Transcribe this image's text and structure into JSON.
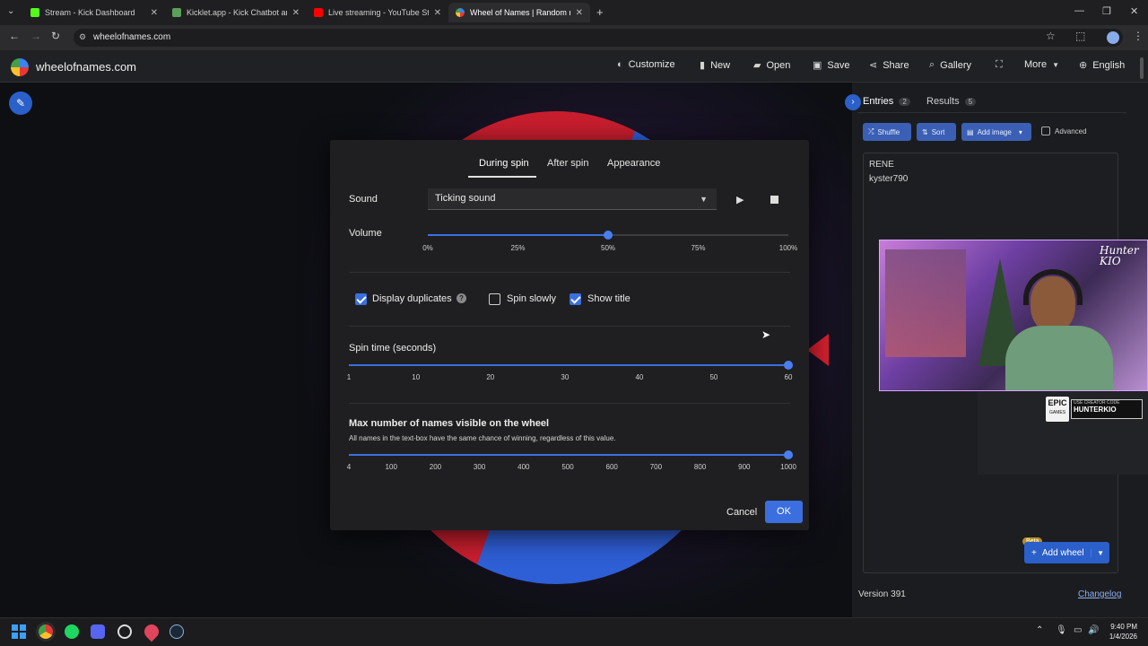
{
  "browser": {
    "tabs": [
      {
        "title": "Stream - Kick Dashboard",
        "color": "#53fc18"
      },
      {
        "title": "Kicklet.app - Kick Chatbot and",
        "color": "#5aa05a"
      },
      {
        "title": "Live streaming - YouTube Studio",
        "color": "#ff0000"
      },
      {
        "title": "Wheel of Names | Random name",
        "color": "#3b82f6"
      }
    ],
    "url": "wheelofnames.com"
  },
  "site": {
    "brand": "wheelofnames.com",
    "nav": [
      {
        "label": "Customize",
        "icon": "palette-icon"
      },
      {
        "label": "New",
        "icon": "file-icon"
      },
      {
        "label": "Open",
        "icon": "folder-icon"
      },
      {
        "label": "Save",
        "icon": "save-icon"
      },
      {
        "label": "Share",
        "icon": "share-icon"
      },
      {
        "label": "Gallery",
        "icon": "search-icon"
      },
      {
        "label": "More",
        "icon": "chevron-down-icon"
      },
      {
        "label": "English",
        "icon": "globe-icon"
      }
    ]
  },
  "sidebar": {
    "entries_label": "Entries",
    "entries_count": "2",
    "results_label": "Results",
    "results_count": "5",
    "shuffle": "Shuffle",
    "sort": "Sort",
    "add_image": "Add image",
    "advanced": "Advanced",
    "entries": [
      "RENE",
      "kyster790"
    ],
    "badge_beta": "Beta",
    "add_wheel": "Add wheel",
    "version": "Version 391",
    "changelog": "Changelog"
  },
  "overlay": {
    "brand_text": "Hunter KIO",
    "epic_line1": "EPIC",
    "epic_line2": "GAMES",
    "code_label": "USE CREATOR CODE",
    "code": "HUNTERKIO"
  },
  "modal": {
    "tabs": [
      "During spin",
      "After spin",
      "Appearance"
    ],
    "sound_label": "Sound",
    "sound_value": "Ticking sound",
    "volume_label": "Volume",
    "volume_value": 0.5,
    "volume_ticks": [
      "0%",
      "25%",
      "50%",
      "75%",
      "100%"
    ],
    "checkboxes": [
      {
        "label": "Display duplicates",
        "checked": true
      },
      {
        "label": "Spin slowly",
        "checked": false
      },
      {
        "label": "Show title",
        "checked": true
      }
    ],
    "spin_time_label": "Spin time (seconds)",
    "spin_time_value": 60,
    "spin_ticks": [
      "1",
      "10",
      "20",
      "30",
      "40",
      "50",
      "60"
    ],
    "max_names_label": "Max number of names visible on the wheel",
    "max_names_hint": "All names in the text-box have the same chance of winning, regardless of this value.",
    "max_names_value": 1000,
    "max_ticks": [
      "4",
      "100",
      "200",
      "300",
      "400",
      "500",
      "600",
      "700",
      "800",
      "900",
      "1000"
    ],
    "cancel": "Cancel",
    "ok": "OK"
  },
  "taskbar": {
    "time": "9:40 PM",
    "date": "1/4/2026"
  },
  "colors": {
    "accent": "#3b6fe0",
    "wheel_red": "#c81e2e",
    "wheel_blue": "#2f5fd6"
  }
}
